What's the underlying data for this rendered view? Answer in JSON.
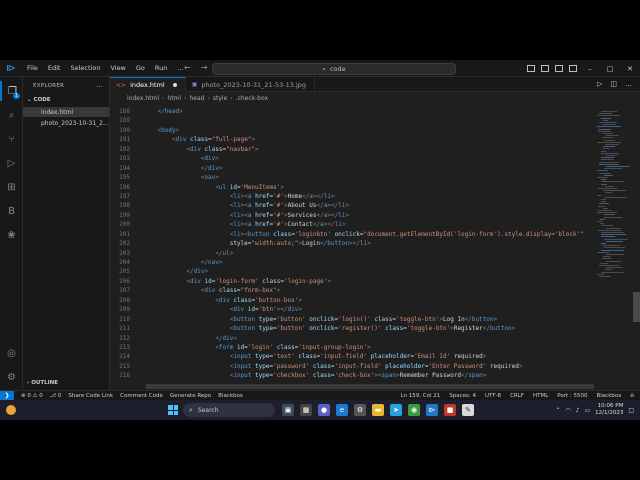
{
  "titlebar": {
    "menu": [
      "File",
      "Edit",
      "Selection",
      "View",
      "Go",
      "Run",
      "…"
    ],
    "search_text": "code",
    "back_glyph": "←",
    "forward_glyph": "→"
  },
  "sidebar": {
    "title": "EXPLORER",
    "section": "CODE",
    "files": [
      "index.html",
      "photo_2023-10-31_2..."
    ],
    "outline": "OUTLINE"
  },
  "tabs": [
    {
      "label": "index.html",
      "icon": "html-file-icon",
      "active": true,
      "modified": true
    },
    {
      "label": "photo_2023-10-31_21-53-13.jpg",
      "icon": "image-file-icon",
      "active": false
    }
  ],
  "breadcrumb": [
    "index.html",
    "html",
    "head",
    "style",
    ".check-box"
  ],
  "editor": {
    "lines": [
      {
        "n": "188",
        "code": "    </head>"
      },
      {
        "n": "189",
        "code": ""
      },
      {
        "n": "190",
        "code": "    <body>"
      },
      {
        "n": "191",
        "code": "        <div class=\"full-page\">"
      },
      {
        "n": "192",
        "code": "            <div class=\"navbar\">"
      },
      {
        "n": "193",
        "code": "                <div>"
      },
      {
        "n": "194",
        "code": "                </div>"
      },
      {
        "n": "195",
        "code": "                <nav>"
      },
      {
        "n": "196",
        "code": "                    <ul id='MenuItems'>"
      },
      {
        "n": "197",
        "code": "                        <li><a href='#'>Home</a></li>"
      },
      {
        "n": "198",
        "code": "                        <li><a href='#'>About Us</a></li>"
      },
      {
        "n": "199",
        "code": "                        <li><a href='#'>Services</a></li>"
      },
      {
        "n": "200",
        "code": "                        <li><a href='#'>Contact</a></li>"
      },
      {
        "n": "201",
        "code": "                        <li><button class='loginbtn' onclick=\"document.getElementById('login-form').style.display='block'\""
      },
      {
        "n": "202",
        "code": "                        style=\"width:auto;\">Login</button></li>"
      },
      {
        "n": "203",
        "code": "                    </ul>"
      },
      {
        "n": "204",
        "code": "                </nav>"
      },
      {
        "n": "205",
        "code": "            </div>"
      },
      {
        "n": "206",
        "code": "            <div id='login-form' class='login-page'>"
      },
      {
        "n": "207",
        "code": "                <div class=\"form-box\">"
      },
      {
        "n": "208",
        "code": "                    <div class='button-box'>"
      },
      {
        "n": "209",
        "code": "                        <div id='btn'></div>"
      },
      {
        "n": "210",
        "code": "                        <button type='button' onclick='login()' class='toggle-btn'>Log In</button>"
      },
      {
        "n": "211",
        "code": "                        <button type='button' onclick='register()' class='toggle-btn'>Register</button>"
      },
      {
        "n": "212",
        "code": "                    </div>"
      },
      {
        "n": "213",
        "code": "                    <form id='login' class='input-group-login'>"
      },
      {
        "n": "214",
        "code": "                        <input type='text' class='input-field' placeholder='Email Id' required>"
      },
      {
        "n": "215",
        "code": "                        <input type='password' class='input-field' placeholder='Enter Password' required>"
      },
      {
        "n": "216",
        "code": "                        <input type='checkbox' class='check-box'><span>Remember Password</span>"
      }
    ]
  },
  "statusbar": {
    "errors": "0",
    "warnings": "0",
    "ports": "0",
    "share": "Share Code Link",
    "items": [
      "Comment Code",
      "Generate Repo",
      "Blackbox"
    ],
    "right_items": [
      "Ln 159, Col 21",
      "Spaces: 4",
      "UTF-8",
      "CRLF",
      "HTML",
      "Port : 5500",
      "Blackbox"
    ]
  },
  "taskbar": {
    "search": "Search",
    "time": "10:06 PM",
    "date": "12/1/2023"
  }
}
